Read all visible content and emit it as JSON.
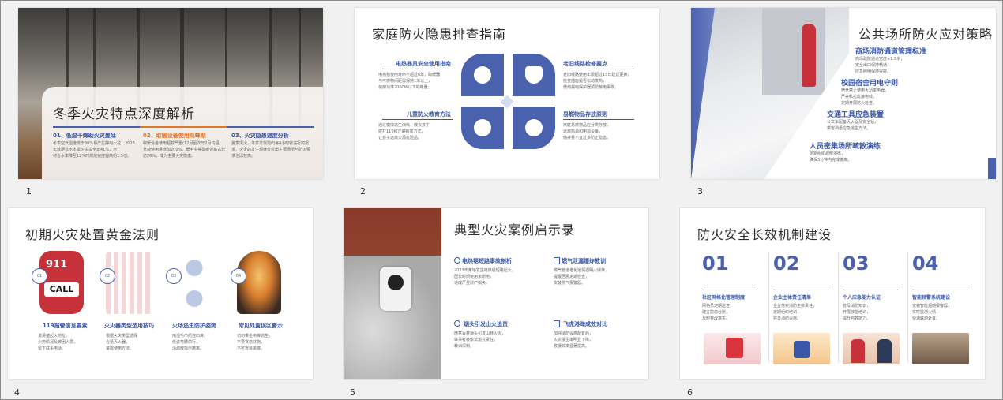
{
  "slides": [
    {
      "number": "1",
      "title": "冬季火灾特点深度解析",
      "items": [
        {
          "head": "01、低温干燥助火灾蔓延",
          "body": [
            "冬季空气湿度低于30%易产生静电火花，2023",
            "年数据显示冬季火灾占全年41%，木",
            "材含水率降至12%时燃烧速度提高约1.5倍。"
          ]
        },
        {
          "head": "02、取暖设备使用高峰期",
          "body": [
            "取暖设备使用超载严重(12月至次年2月均超",
            "负荷使用量增加200%，暖手宝等取暖设备占比",
            "达26%，成为主要火灾隐患。"
          ]
        },
        {
          "head": "03、火灾隐患速度分析",
          "body": [
            "夏季灾火，冬季发现需约每4小时就进行的需",
            "求，火灾的发生规律分析出主要场所与防火要",
            "求也比较高。"
          ]
        }
      ]
    },
    {
      "number": "2",
      "title": "家庭防火隐患排查指南",
      "items": [
        {
          "head": "电热器具安全使用指南",
          "body": [
            "电热毯使用寿命不超过6年，取暖器",
            "与可燃物间距需保持1米以上，",
            "使用功率2000W以下的电器。"
          ]
        },
        {
          "head": "老旧线路检修要点",
          "body": [
            "老旧线路使用年限超过15年建议更换，",
            "检查插座是否松动发热，",
            "使用漏电保护器预防触电事故。"
          ]
        },
        {
          "head": "儿童防火教育方法",
          "body": [
            "通过模拟逃生演练，教会孩子",
            "拨打119和正确报警方式，",
            "让孩子远离火源危险品。"
          ]
        },
        {
          "head": "易燃物品存放原则",
          "body": [
            "家庭易燃物品应分类存放，",
            "远离热源和电源设备，",
            "储存量不宜过多防止隐患。"
          ]
        }
      ]
    },
    {
      "number": "3",
      "title": "公共场所防火应对策略",
      "items": [
        {
          "head": "商场消防通道管理标准",
          "body": [
            "商场疏散通道宽度≥1.5米，",
            "安全出口保持畅通，",
            "应急照明保持完好。"
          ]
        },
        {
          "head": "校园宿舍用电守则",
          "body": [
            "宿舍禁止使用大功率电器，",
            "严禁私拉乱接电线，",
            "定期开展防火检查。"
          ]
        },
        {
          "head": "交通工具应急装置",
          "body": [
            "公交车配备灭火器及安全锤，",
            "乘客熟悉应急逃生方法。"
          ]
        },
        {
          "head": "人员密集场所疏散演练",
          "body": [
            "定期组织疏散演练，",
            "确保3分钟内完成撤离。"
          ]
        }
      ]
    },
    {
      "number": "4",
      "title": "初期火灾处置黄金法则",
      "items": [
        {
          "badge": "01",
          "head": "119报警信息要素",
          "body": [
            "说清楚起火地址，",
            "火势情况及被困人员，",
            "留下联系电话。"
          ]
        },
        {
          "badge": "02",
          "head": "灭火器类型选用技巧",
          "body": [
            "根据火灾类型选择",
            "合适灭火器，",
            "掌握使用方法。"
          ]
        },
        {
          "badge": "03",
          "head": "火场逃生防护姿势",
          "body": [
            "用湿毛巾捂住口鼻，",
            "低姿弯腰前行，",
            "沿疏散指示撤离。"
          ]
        },
        {
          "badge": "04",
          "head": "常见处置误区警示",
          "body": [
            "切勿乘坐电梯逃生，",
            "不要贪恋财物，",
            "不可盲目跳楼。"
          ]
        }
      ],
      "call_label": "CALL",
      "call_num": "911"
    },
    {
      "number": "5",
      "title": "典型火灾案例启示录",
      "items": [
        {
          "head": "电热毯短路事故剖析",
          "body": [
            "2023年某地发生电热毯短路起火，",
            "因长时间使用未断电，",
            "造成严重财产损失。"
          ]
        },
        {
          "head": "燃气泄漏爆炸教训",
          "body": [
            "燃气管道老化泄漏遇明火爆炸，",
            "提醒居民定期检查，",
            "安装燃气报警器。"
          ]
        },
        {
          "head": "烟头引发山火追责",
          "body": [
            "随意丢弃烟头引发山林火灾，",
            "肇事者被依法追究责任，",
            "教训深刻。"
          ]
        },
        {
          "head": "飞虎港海成效对比",
          "body": [
            "加强消防设施配置后，",
            "火灾发生率明显下降，",
            "救援效率显著提高。"
          ]
        }
      ]
    },
    {
      "number": "6",
      "title": "防火安全长效机制建设",
      "items": [
        {
          "num": "01",
          "head": "社区网格化管理制度",
          "body": [
            "网格员定期巡查，",
            "建立隐患台账，",
            "及时整改落实。"
          ]
        },
        {
          "num": "02",
          "head": "企业主体责任清单",
          "body": [
            "企业落实消防主体责任，",
            "定期组织培训，",
            "完善消防设施。"
          ]
        },
        {
          "num": "03",
          "head": "个人应急能力认证",
          "body": [
            "普及消防知识，",
            "开展技能培训，",
            "提升自救能力。"
          ]
        },
        {
          "num": "04",
          "head": "智能预警系统建设",
          "body": [
            "安装智能烟感报警器，",
            "实时监测火情，",
            "快速联动处置。"
          ]
        }
      ]
    }
  ],
  "colors": {
    "accent": "#4a61ae",
    "accent_dark": "#3a57a8",
    "fire_red": "#c7313a",
    "orange": "#e0782b"
  }
}
